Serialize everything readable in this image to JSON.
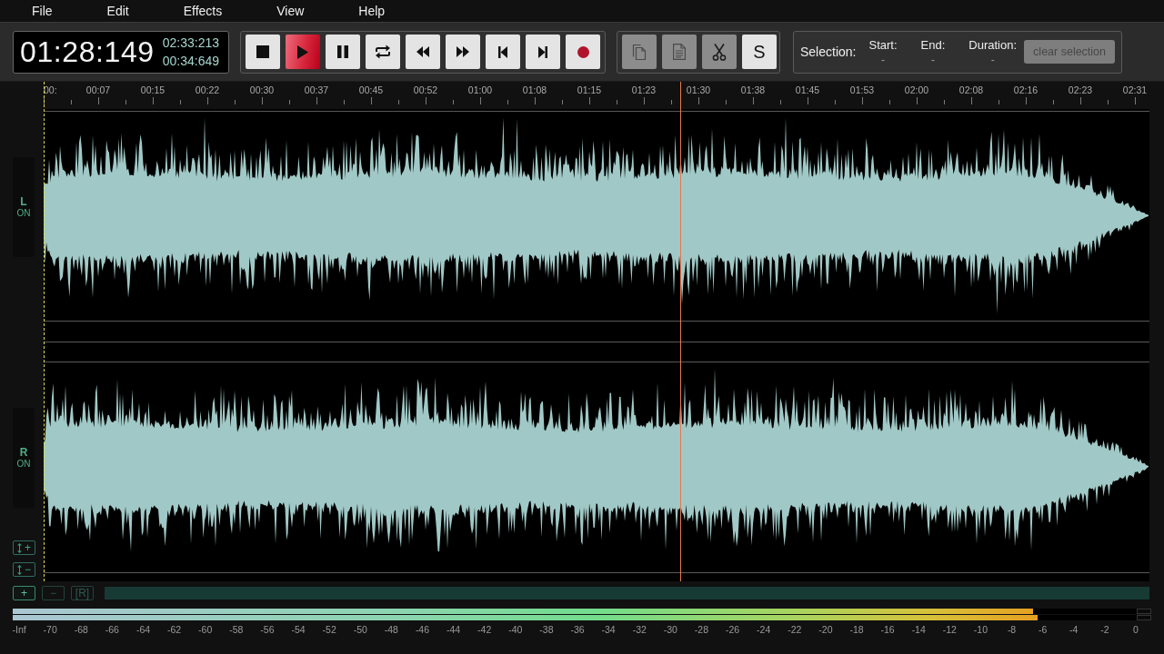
{
  "menu": [
    "File",
    "Edit",
    "Effects",
    "View",
    "Help"
  ],
  "time_display": {
    "current": "01:28:149",
    "readouts": [
      "02:33:213",
      "00:34:649"
    ]
  },
  "transport": [
    {
      "kind": "stop",
      "active": false
    },
    {
      "kind": "play",
      "active": true
    },
    {
      "kind": "pause",
      "active": false
    },
    {
      "kind": "loop",
      "active": false
    },
    {
      "kind": "rewind",
      "active": false
    },
    {
      "kind": "fast_forward",
      "active": false
    },
    {
      "kind": "skip_start",
      "active": false
    },
    {
      "kind": "skip_end",
      "active": false
    },
    {
      "kind": "record",
      "active": false
    }
  ],
  "edit_tools": [
    {
      "kind": "copy",
      "disabled": true
    },
    {
      "kind": "paste",
      "disabled": true
    },
    {
      "kind": "cut",
      "disabled": true
    },
    {
      "kind": "text",
      "label": "S",
      "disabled": false
    }
  ],
  "selection": {
    "title": "Selection:",
    "fields": [
      {
        "label": "Start:",
        "value": "-"
      },
      {
        "label": "End:",
        "value": "-"
      },
      {
        "label": "Duration:",
        "value": "-"
      }
    ],
    "clear_button": {
      "label": "clear selection",
      "disabled": true
    }
  },
  "ruler": [
    "00:",
    "00:07",
    "00:15",
    "00:22",
    "00:30",
    "00:37",
    "00:45",
    "00:52",
    "01:00",
    "01:08",
    "01:15",
    "01:23",
    "01:30",
    "01:38",
    "01:45",
    "01:53",
    "02:00",
    "02:08",
    "02:16",
    "02:23",
    "02:31"
  ],
  "channels": [
    {
      "label": "L",
      "status": "ON",
      "on": true
    },
    {
      "label": "R",
      "status": "ON",
      "on": true
    }
  ],
  "playhead": {
    "level": 0.576
  },
  "vertical_zoom": [
    {
      "label": "+"
    },
    {
      "label": "−"
    }
  ],
  "zoom_buttons": [
    {
      "label": "+",
      "disabled": false
    },
    {
      "label": "−",
      "disabled": true
    },
    {
      "label": "[R]",
      "disabled": true
    }
  ],
  "level_meter": {
    "channels": [
      {
        "level": 0.908
      },
      {
        "level": 0.912
      }
    ],
    "scale": [
      "-Inf",
      "-70",
      "-68",
      "-66",
      "-64",
      "-62",
      "-60",
      "-58",
      "-56",
      "-54",
      "-52",
      "-50",
      "-48",
      "-46",
      "-44",
      "-42",
      "-40",
      "-38",
      "-36",
      "-34",
      "-32",
      "-30",
      "-28",
      "-26",
      "-24",
      "-22",
      "-20",
      "-18",
      "-16",
      "-14",
      "-12",
      "-10",
      "-8",
      "-6",
      "-4",
      "-2",
      "0"
    ]
  }
}
